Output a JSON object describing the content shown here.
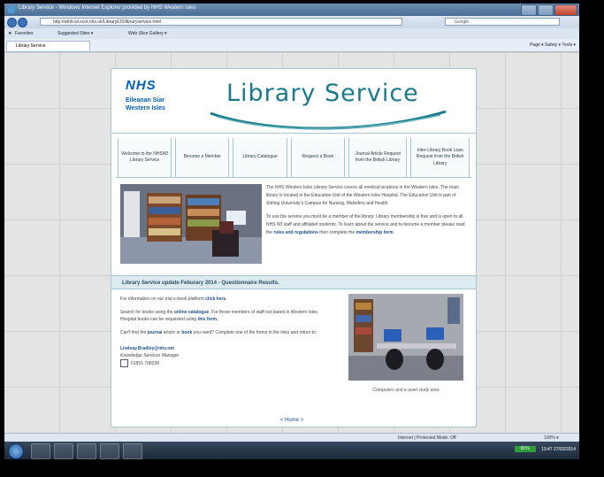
{
  "window": {
    "title": "Library Service - Windows Internet Explorer provided by NHS Western Isles"
  },
  "address_bar": {
    "url": "http://wihb.wi.scot.nhs.uk/LibraryEIS/libraryservice.html",
    "search_placeholder": "Google"
  },
  "favorites_bar": {
    "favorites_label": "Favorites",
    "suggested_sites": "Suggested Sites ▾",
    "web_slice": "Web Slice Gallery ▾"
  },
  "tab": {
    "label": "Library Service"
  },
  "toolbar": {
    "items": "Page ▾  Safety ▾  Tools ▾"
  },
  "site": {
    "nhs_logo": "NHS",
    "org_line1": "Eileanan Siar",
    "org_line2": "Western Isles",
    "title": "Library Service",
    "accent_color": "#1a7a8c",
    "nhs_blue": "#005eb8",
    "menu": [
      "Welcome to the NHSWI Library Service",
      "Become a Member",
      "Library Catalogue",
      "Request a Book",
      "Journal Article Request from the British Library",
      "Inter-Library Book Loan Request from the British Library"
    ],
    "intro_p1": "The NHS Western Isles Library Service covers all medical locations in the Western Isles. The main library is located in the Education Unit of the Western Isles Hospital. The Education Unit is part of Stirling University's Campus for Nursing, Midwifery and Health.",
    "intro_p2_a": "To use the service you must be a member of the library. Library membership is free and is open to all NHS WI staff and affiliated students. To learn about the service and to become a member please read the ",
    "intro_p2_link1": "rules and regulations",
    "intro_p2_b": " then complete the ",
    "intro_p2_link2": "membership form",
    "update_banner": "Library Service update Feburary 2014 - Questionnaire Results.",
    "trial_a": "For information on our trial e-book platform ",
    "trial_link": "click here.",
    "search_a": "Search for books using the ",
    "search_link": "online catalogue",
    "search_b": ". For those members of staff not based in Western Isles Hospital books can be requested using ",
    "search_link2": "this form.",
    "cant_find_a": "Can't find the ",
    "cant_find_journal": "journal",
    "cant_find_b": " article or ",
    "cant_find_book": "book",
    "cant_find_c": " you need? Complete one of the forms in the links and return to:",
    "contact_email": "Lindsay.Bradley@nhs.net",
    "contact_role": "Knowledge Services Manager",
    "contact_phone": "01851 708238",
    "caption": "Computers and a quiet study area",
    "home_link": "< Home >"
  },
  "status_bar": {
    "zone": "Internet | Protected Mode: Off",
    "zoom": "100% ▾"
  },
  "taskbar": {
    "battery": "91%",
    "time": "13:47",
    "date": "27/02/2014"
  }
}
